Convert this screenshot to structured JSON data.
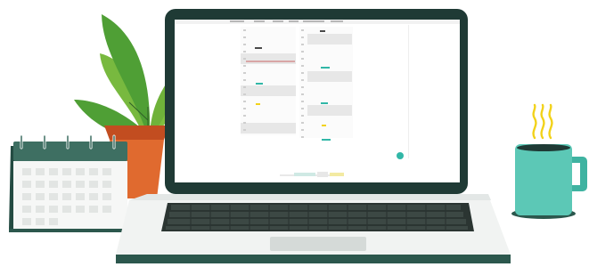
{
  "screen": {
    "menu_labels": [
      "",
      "",
      "",
      "",
      "",
      ""
    ],
    "footer_labels": [
      "",
      "",
      ""
    ]
  },
  "colors": {
    "laptop_frame": "#1f3a35",
    "plant_leaf": "#7fbf3f",
    "pot": "#e06a2f",
    "calendar_header": "#3e6f62",
    "mug": "#5cc8b6",
    "steam": "#f2d21a",
    "accent_teal": "#31b7a7",
    "accent_yellow": "#f2d21a"
  },
  "icons": {
    "plant": "plant-icon",
    "calendar": "calendar-icon",
    "mug": "coffee-mug-icon",
    "steam": "steam-icon"
  }
}
